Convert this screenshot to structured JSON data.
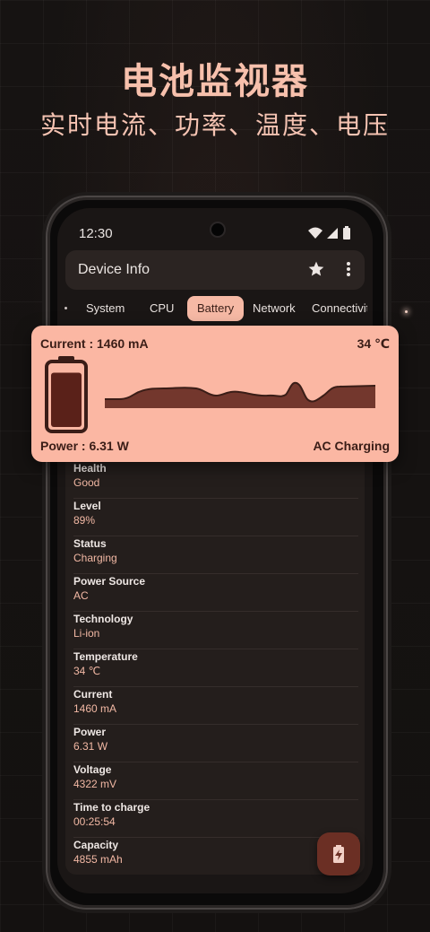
{
  "promo": {
    "title": "电池监视器",
    "subtitle": "实时电流、功率、温度、电压"
  },
  "status_bar": {
    "time": "12:30",
    "icons": [
      "wifi-icon",
      "signal-icon",
      "battery-icon"
    ]
  },
  "app_bar": {
    "title": "Device Info",
    "actions": [
      "star-icon",
      "more-vert-icon"
    ]
  },
  "tabs": [
    {
      "label": "System",
      "active": false
    },
    {
      "label": "CPU",
      "active": false
    },
    {
      "label": "Battery",
      "active": true
    },
    {
      "label": "Network",
      "active": false
    },
    {
      "label": "Connectivit",
      "active": false
    }
  ],
  "battery_card": {
    "current": "Current : 1460 mA",
    "temperature": "34 ℃",
    "power": "Power : 6.31 W",
    "charging": "AC Charging",
    "level_fraction": 0.89
  },
  "battery_info": [
    {
      "label": "Health",
      "value": "Good"
    },
    {
      "label": "Level",
      "value": "89%"
    },
    {
      "label": "Status",
      "value": "Charging"
    },
    {
      "label": "Power Source",
      "value": "AC"
    },
    {
      "label": "Technology",
      "value": "Li-ion"
    },
    {
      "label": "Temperature",
      "value": "34 ℃"
    },
    {
      "label": "Current",
      "value": "1460 mA"
    },
    {
      "label": "Power",
      "value": "6.31 W"
    },
    {
      "label": "Voltage",
      "value": "4322 mV"
    },
    {
      "label": "Time to charge",
      "value": "00:25:54"
    },
    {
      "label": "Capacity",
      "value": "4855 mAh"
    }
  ],
  "fab": {
    "icon": "battery-charging-icon"
  },
  "colors": {
    "accent": "#fbb7a3",
    "accent_dark": "#6b2f24",
    "value_text": "#f2b8a4",
    "background": "#141110"
  }
}
